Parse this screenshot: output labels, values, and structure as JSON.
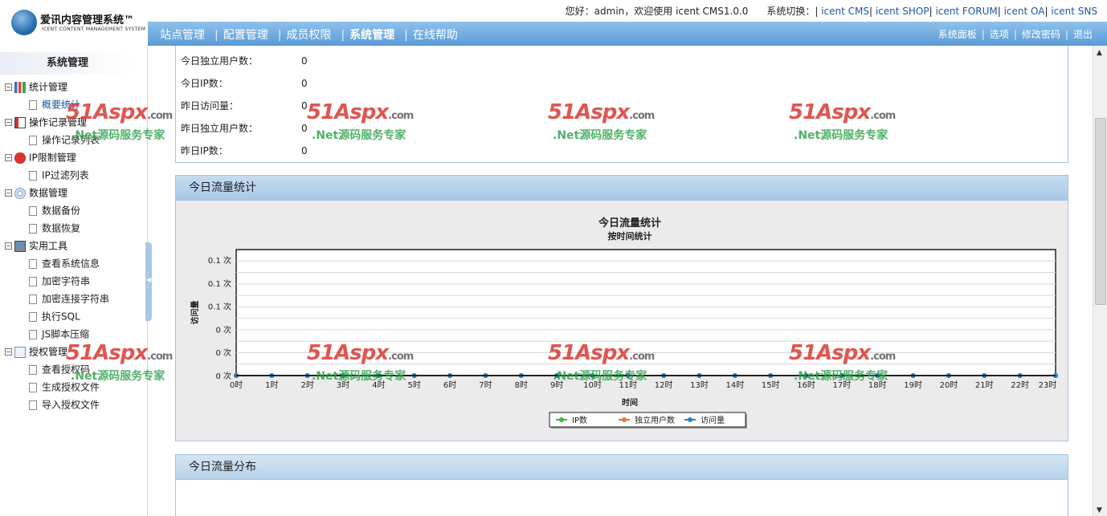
{
  "header": {
    "logo_title": "爱讯内容管理系统™",
    "logo_subtitle": "ICENT CONTENT MANAGEMENT SYSTEM",
    "welcome": "您好：admin，欢迎使用  icent CMS1.0.0",
    "switch_label": "系统切换：",
    "systems": [
      "icent CMS",
      "icent SHOP",
      "icent FORUM",
      "icent OA",
      "icent SNS"
    ],
    "nav": [
      "站点管理",
      "配置管理",
      "成员权限",
      "系统管理",
      "在线帮助"
    ],
    "nav_active": 3,
    "right_links": [
      "系统面板",
      "选项",
      "修改密码",
      "退出"
    ]
  },
  "sidebar": {
    "title": "系统管理",
    "groups": [
      {
        "label": "统计管理",
        "icon": "bar-chart-icon",
        "items": [
          "概要统计"
        ]
      },
      {
        "label": "操作记录管理",
        "icon": "log-icon",
        "items": [
          "操作记录列表"
        ]
      },
      {
        "label": "IP限制管理",
        "icon": "block-icon",
        "items": [
          "IP过滤列表"
        ]
      },
      {
        "label": "数据管理",
        "icon": "disc-icon",
        "items": [
          "数据备份",
          "数据恢复"
        ]
      },
      {
        "label": "实用工具",
        "icon": "computer-icon",
        "items": [
          "查看系统信息",
          "加密字符串",
          "加密连接字符串",
          "执行SQL",
          "JS脚本压缩"
        ]
      },
      {
        "label": "授权管理",
        "icon": "document-icon",
        "items": [
          "查看授权码",
          "生成授权文件",
          "导入授权文件"
        ]
      }
    ]
  },
  "stats": {
    "rows": [
      {
        "label": "今日独立用户数：",
        "value": "0"
      },
      {
        "label": "今日IP数：",
        "value": "0"
      },
      {
        "label": "昨日访问量：",
        "value": "0"
      },
      {
        "label": "昨日独立用户数：",
        "value": "0"
      },
      {
        "label": "昨日IP数：",
        "value": "0"
      }
    ]
  },
  "traffic_panel": {
    "title": "今日流量统计"
  },
  "dist_panel": {
    "title": "今日流量分布"
  },
  "watermark": {
    "brand": "51Aspx",
    "suffix": ".com",
    "slogan": ".Net源码服务专家"
  },
  "chart_data": {
    "type": "line",
    "title": "今日流量统计",
    "subtitle": "按时间统计",
    "xlabel": "时间",
    "ylabel": "访问量",
    "categories": [
      "0时",
      "1时",
      "2时",
      "3时",
      "4时",
      "5时",
      "6时",
      "7时",
      "8时",
      "9时",
      "10时",
      "11时",
      "12时",
      "13时",
      "14时",
      "15时",
      "16时",
      "17时",
      "18时",
      "19时",
      "20时",
      "21时",
      "22时",
      "23时"
    ],
    "y_tick_labels": [
      "0 次",
      "0 次",
      "0 次",
      "0.1 次",
      "0.1 次",
      "0.1 次"
    ],
    "ylim": [
      0,
      0.1
    ],
    "grid": true,
    "legend_position": "bottom",
    "series": [
      {
        "name": "IP数",
        "color": "#3cba3c",
        "values": [
          0,
          0,
          0,
          0,
          0,
          0,
          0,
          0,
          0,
          0,
          0,
          0,
          0,
          0,
          0,
          0,
          0,
          0,
          0,
          0,
          0,
          0,
          0,
          0
        ]
      },
      {
        "name": "独立用户数",
        "color": "#e8743b",
        "values": [
          0,
          0,
          0,
          0,
          0,
          0,
          0,
          0,
          0,
          0,
          0,
          0,
          0,
          0,
          0,
          0,
          0,
          0,
          0,
          0,
          0,
          0,
          0,
          0
        ]
      },
      {
        "name": "访问量",
        "color": "#2a7fc8",
        "values": [
          0,
          0,
          0,
          0,
          0,
          0,
          0,
          0,
          0,
          0,
          0,
          0,
          0,
          0,
          0,
          0,
          0,
          0,
          0,
          0,
          0,
          0,
          0,
          0
        ]
      }
    ]
  }
}
